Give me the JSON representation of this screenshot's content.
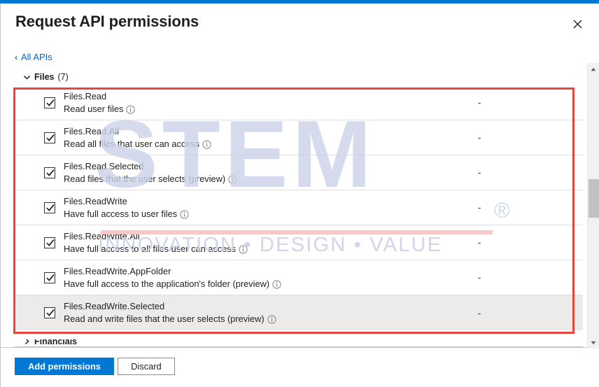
{
  "window": {
    "accent_color": "#0078d4",
    "annotation_color": "#e8453c"
  },
  "header": {
    "title": "Request API permissions",
    "close_icon": "close-icon"
  },
  "breadcrumb": {
    "back_chevron": "‹",
    "label": "All APIs"
  },
  "group": {
    "expand_chevron": "chevron-down-icon",
    "name": "Files",
    "count": "(7)"
  },
  "permissions": [
    {
      "checked": true,
      "name": "Files.Read",
      "description": "Read user files",
      "info": "info-icon",
      "admin_consent": "-",
      "selected": false
    },
    {
      "checked": true,
      "name": "Files.Read.All",
      "description": "Read all files that user can access",
      "info": "info-icon",
      "admin_consent": "-",
      "selected": false
    },
    {
      "checked": true,
      "name": "Files.Read.Selected",
      "description": "Read files that the user selects (preview)",
      "info": "info-icon",
      "admin_consent": "-",
      "selected": false
    },
    {
      "checked": true,
      "name": "Files.ReadWrite",
      "description": "Have full access to user files",
      "info": "info-icon",
      "admin_consent": "-",
      "selected": false
    },
    {
      "checked": true,
      "name": "Files.ReadWrite.All",
      "description": "Have full access to all files user can access",
      "info": "info-icon",
      "admin_consent": "-",
      "selected": false
    },
    {
      "checked": true,
      "name": "Files.ReadWrite.AppFolder",
      "description": "Have full access to the application's folder (preview)",
      "info": "info-icon",
      "admin_consent": "-",
      "selected": false
    },
    {
      "checked": true,
      "name": "Files.ReadWrite.Selected",
      "description": "Read and write files that the user selects (preview)",
      "info": "info-icon",
      "admin_consent": "-",
      "selected": true
    }
  ],
  "next_group": {
    "name": "Financials"
  },
  "footer": {
    "primary_label": "Add permissions",
    "secondary_label": "Discard"
  },
  "scrollbar": {
    "up_arrow": "scroll-up-arrow-icon",
    "down_arrow": "scroll-down-arrow-icon"
  },
  "watermark": {
    "brand": "STEM",
    "registered": "®",
    "tagline": "INNOVATION  •  DESIGN  •  VALUE"
  }
}
